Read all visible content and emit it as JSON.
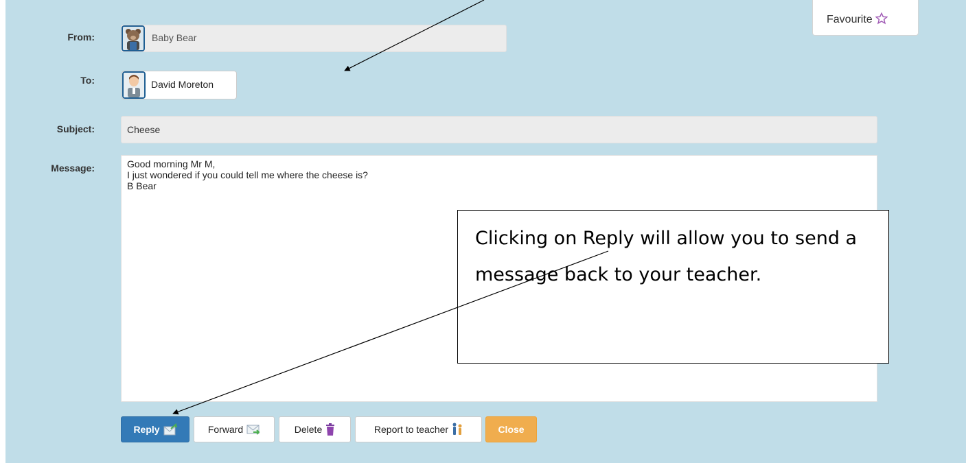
{
  "favourite": {
    "label": "Favourite"
  },
  "from": {
    "label": "From:",
    "value": "Baby Bear"
  },
  "to": {
    "label": "To:",
    "recipient": "David Moreton"
  },
  "subject": {
    "label": "Subject:",
    "value": "Cheese"
  },
  "message": {
    "label": "Message:",
    "lines": [
      "Good morning Mr M,",
      "I just wondered if you could tell me where the cheese is?",
      "B Bear"
    ]
  },
  "buttons": {
    "reply": "Reply",
    "forward": "Forward",
    "delete": "Delete",
    "report": "Report to teacher",
    "close": "Close"
  },
  "callout": {
    "text": "Clicking on Reply will allow you to send a message back to your teacher."
  },
  "colors": {
    "panel_bg": "#c0dde8",
    "primary": "#337ab7",
    "warning": "#f0ad4e",
    "favourite_star": "#a05ab5"
  },
  "icons": [
    "bear-avatar-icon",
    "teacher-avatar-icon",
    "star-icon",
    "envelope-reply-icon",
    "envelope-forward-icon",
    "trash-icon",
    "report-icon"
  ]
}
